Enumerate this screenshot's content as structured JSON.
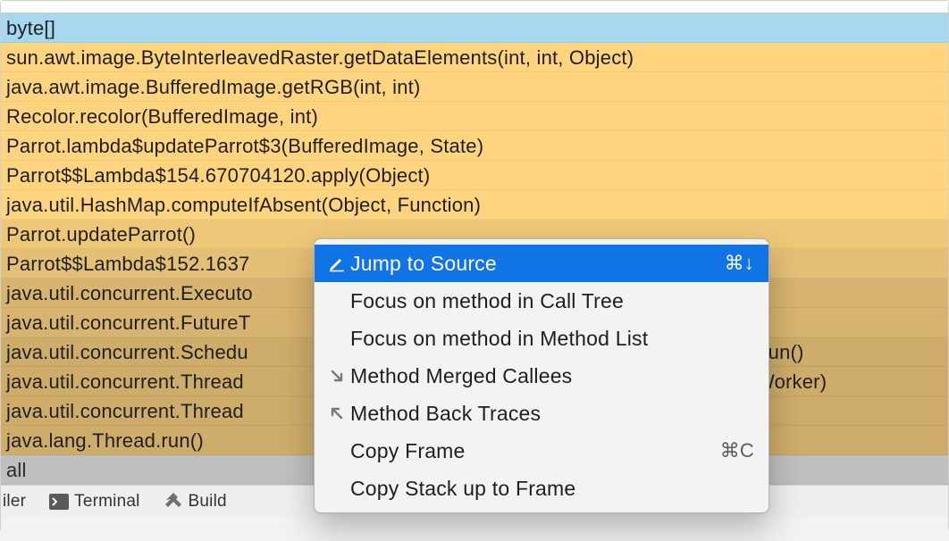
{
  "rows": [
    {
      "text": "byte[]",
      "cls": "row-blue"
    },
    {
      "text": "sun.awt.image.ByteInterleavedRaster.getDataElements(int, int, Object)",
      "cls": "row-bright"
    },
    {
      "text": "java.awt.image.BufferedImage.getRGB(int, int)",
      "cls": "row-bright"
    },
    {
      "text": "Recolor.recolor(BufferedImage, int)",
      "cls": "row-bright"
    },
    {
      "text": "Parrot.lambda$updateParrot$3(BufferedImage, State)",
      "cls": "row-bright"
    },
    {
      "text": "Parrot$$Lambda$154.670704120.apply(Object)",
      "cls": "row-bright"
    },
    {
      "text": "java.util.HashMap.computeIfAbsent(Object, Function)",
      "cls": "row-bright"
    },
    {
      "text": "Parrot.updateParrot()",
      "cls": "row-mid"
    },
    {
      "text": "Parrot$$Lambda$152.1637",
      "cls": "row-mid2"
    },
    {
      "text": "java.util.concurrent.Executo",
      "cls": "row-dark"
    },
    {
      "text": "java.util.concurrent.FutureT",
      "cls": "row-dark"
    },
    {
      "text_left": "java.util.concurrent.Schedu",
      "text_right": "Task.run()",
      "cls": "row-darker"
    },
    {
      "text_left": "java.util.concurrent.Thread",
      "text_right": "utor$Worker)",
      "cls": "row-darker"
    },
    {
      "text": "java.util.concurrent.Thread",
      "cls": "row-darker"
    },
    {
      "text": "java.lang.Thread.run()",
      "cls": "row-darker"
    },
    {
      "text": "all",
      "cls": "row-all"
    }
  ],
  "context_menu": {
    "items": [
      {
        "label": "Jump to Source",
        "icon": "edit-icon",
        "shortcut": "⌘↓",
        "selected": true
      },
      {
        "label": "Focus on method in Call Tree",
        "icon": "",
        "shortcut": ""
      },
      {
        "label": "Focus on method in Method List",
        "icon": "",
        "shortcut": ""
      },
      {
        "label": "Method Merged Callees",
        "icon": "arrow-dr-icon",
        "shortcut": ""
      },
      {
        "label": "Method Back Traces",
        "icon": "arrow-ul-icon",
        "shortcut": ""
      },
      {
        "label": "Copy Frame",
        "icon": "",
        "shortcut": "⌘C"
      },
      {
        "label": "Copy Stack up to Frame",
        "icon": "",
        "shortcut": ""
      }
    ]
  },
  "bottom": {
    "tab_left": "iler",
    "terminal": "Terminal",
    "build": "Build"
  }
}
